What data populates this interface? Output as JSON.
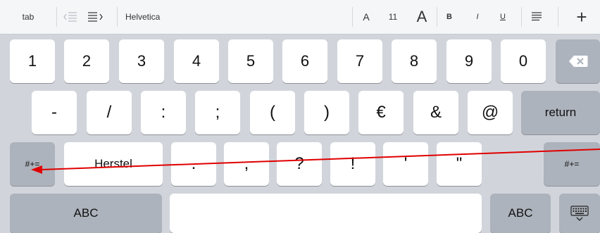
{
  "toolbar": {
    "tab_label": "tab",
    "outdent_icon": "outdent-icon",
    "indent_icon": "indent-icon",
    "font_name": "Helvetica",
    "font_decrease_label": "A",
    "font_size": "11",
    "font_increase_label": "A",
    "bold_label": "B",
    "italic_label": "I",
    "underline_label": "U",
    "align_icon": "align-left-icon",
    "insert_label": "+"
  },
  "keyboard": {
    "row1": [
      "1",
      "2",
      "3",
      "4",
      "5",
      "6",
      "7",
      "8",
      "9",
      "0"
    ],
    "row2": [
      "-",
      "/",
      ":",
      ";",
      "(",
      ")",
      "€",
      "&",
      "@"
    ],
    "return_label": "return",
    "row3_left_label": "#+=",
    "undo_label": "Herstel",
    "row3": [
      ".",
      ",",
      "?",
      "!",
      "'",
      "\""
    ],
    "row3_right_label": "#+=",
    "abc_left_label": "ABC",
    "abc_right_label": "ABC",
    "backspace_icon": "backspace-icon",
    "dismiss_icon": "keyboard-dismiss-icon"
  },
  "annotation": {
    "arrow_color": "#e00000"
  },
  "colors": {
    "key_light": "#ffffff",
    "key_dark": "#adb3bc",
    "keyboard_bg": "#d1d5db",
    "toolbar_bg": "#f5f6f8"
  }
}
